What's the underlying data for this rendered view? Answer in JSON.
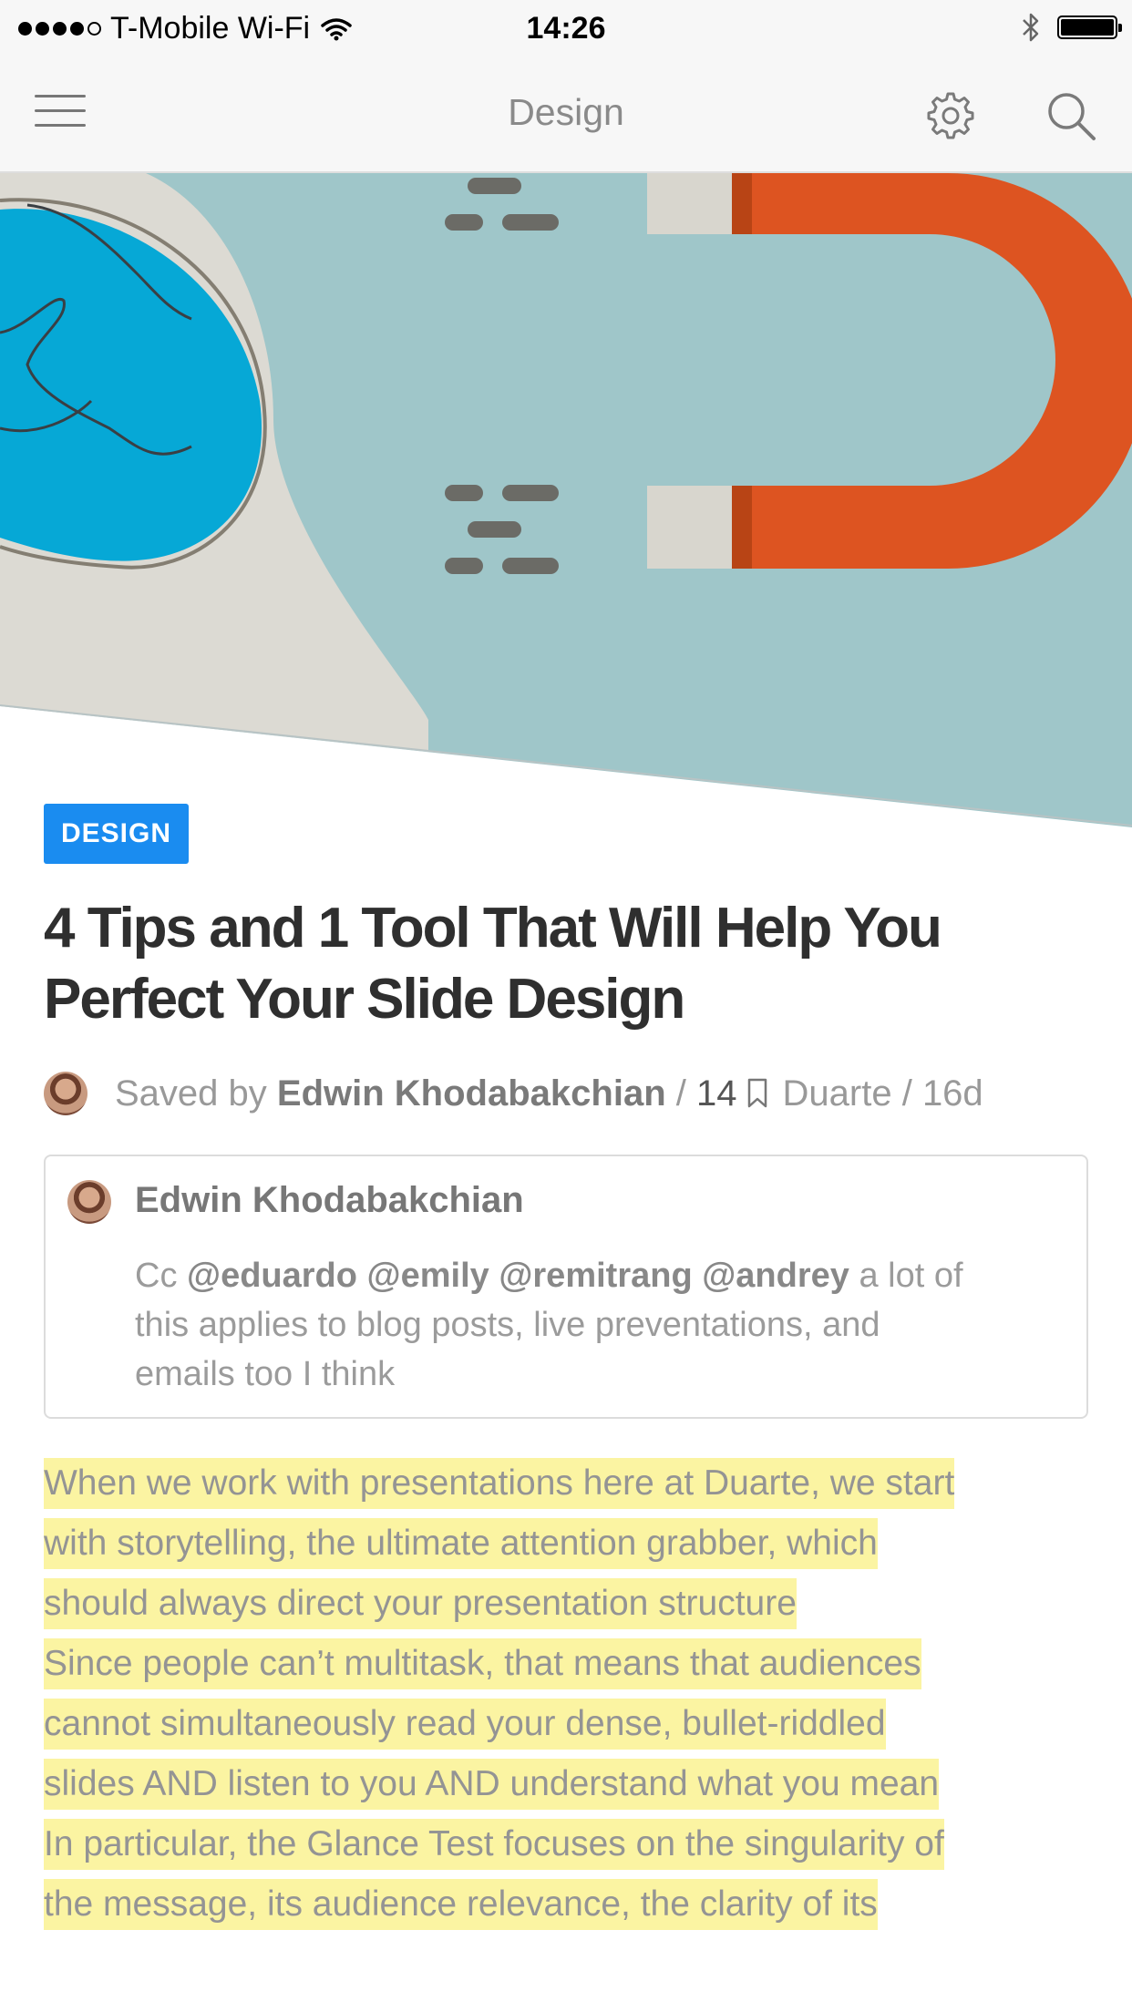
{
  "status_bar": {
    "carrier": "T-Mobile Wi-Fi",
    "time": "14:26",
    "battery_level": 1.0
  },
  "nav": {
    "title": "Design",
    "icons": [
      "menu-icon",
      "gear-icon",
      "search-icon"
    ]
  },
  "article": {
    "category_tag": "DESIGN",
    "title": "4 Tips and 1 Tool That Will Help You Perfect Your Slide Design",
    "saved_by_label": "Saved by",
    "author": "Edwin Khodabakchian",
    "separator": "/",
    "save_count": "14",
    "source": "Duarte",
    "age": "16d"
  },
  "comment": {
    "author": "Edwin Khodabakchian",
    "prefix": "Cc",
    "mentions": [
      "@eduardo",
      "@emily",
      "@remitrang",
      "@andrey"
    ],
    "line1_tail": "a lot of",
    "line2": "this applies to blog posts, live preventations, and",
    "line3": "emails too I think"
  },
  "highlights": [
    "When we work with presentations here at Duarte, we start",
    "with storytelling, the ultimate attention grabber, which",
    "should always direct your presentation structure",
    "Since people can’t multitask, that means that audiences",
    "cannot simultaneously read your dense, bullet-riddled",
    "slides AND listen to you AND understand what you mean",
    "In particular, the Glance Test focuses on the singularity of",
    "the message, its audience relevance, the clarity of its"
  ],
  "colors": {
    "accent_blue": "#1a8cf0",
    "highlight_yellow": "#fbf4a2",
    "hero_teal": "#9fc6c9",
    "magnet_orange": "#dd5421",
    "brain_blue": "#06a8d6"
  }
}
